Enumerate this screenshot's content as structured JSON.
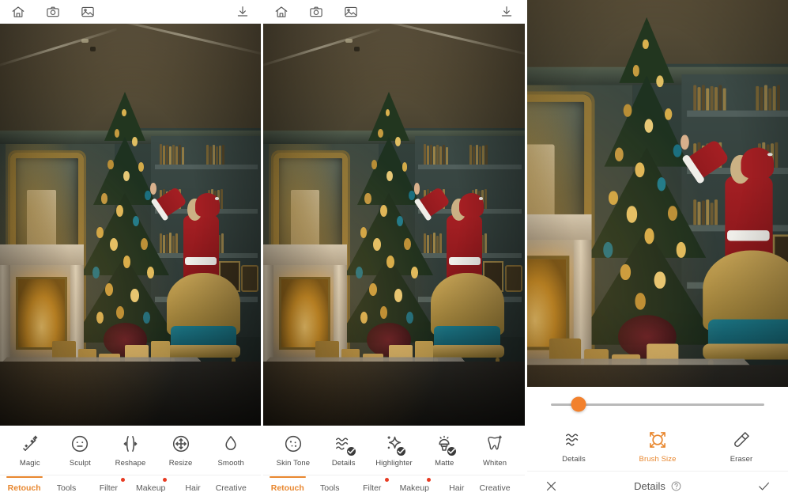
{
  "app": {
    "accent": "#e8872f",
    "slider_accent": "#f2812d",
    "badge_red": "#e83b22"
  },
  "topbar": {
    "icons": [
      {
        "name": "home-icon",
        "label": "Home"
      },
      {
        "name": "camera-icon",
        "label": "Camera"
      },
      {
        "name": "gallery-icon",
        "label": "Gallery"
      }
    ],
    "download": {
      "name": "download-icon",
      "label": "Save"
    }
  },
  "tabs": [
    {
      "label": "Retouch",
      "active": true,
      "dot": false
    },
    {
      "label": "Tools",
      "active": false,
      "dot": false
    },
    {
      "label": "Filter",
      "active": false,
      "dot": true
    },
    {
      "label": "Makeup",
      "active": false,
      "dot": true
    },
    {
      "label": "Hair",
      "active": false,
      "dot": false
    },
    {
      "label": "Creative",
      "active": false,
      "dot": false
    }
  ],
  "panel1": {
    "tools": [
      {
        "label": "Magic",
        "icon": "magic-wand-icon",
        "active": false,
        "checked": false
      },
      {
        "label": "Sculpt",
        "icon": "face-sculpt-icon",
        "active": false,
        "checked": false
      },
      {
        "label": "Reshape",
        "icon": "reshape-icon",
        "active": false,
        "checked": false
      },
      {
        "label": "Resize",
        "icon": "resize-icon",
        "active": false,
        "checked": false
      },
      {
        "label": "Smooth",
        "icon": "droplet-icon",
        "active": false,
        "checked": false
      }
    ]
  },
  "panel2": {
    "tools": [
      {
        "label": "Skin Tone",
        "icon": "skin-tone-icon",
        "active": false,
        "checked": false
      },
      {
        "label": "Details",
        "icon": "details-waves-icon",
        "active": false,
        "checked": true
      },
      {
        "label": "Highlighter",
        "icon": "sparkle-icon",
        "active": false,
        "checked": true
      },
      {
        "label": "Matte",
        "icon": "powder-puff-icon",
        "active": false,
        "checked": true
      },
      {
        "label": "Whiten",
        "icon": "tooth-icon",
        "active": false,
        "checked": false
      }
    ]
  },
  "panel3": {
    "slider": {
      "name": "brush-size-slider",
      "value": 13,
      "min": 0,
      "max": 100
    },
    "tools": [
      {
        "label": "Details",
        "icon": "details-waves-icon",
        "active": false
      },
      {
        "label": "Brush Size",
        "icon": "brush-size-icon",
        "active": true
      },
      {
        "label": "Eraser",
        "icon": "eraser-icon",
        "active": false
      }
    ],
    "footer": {
      "cancel": {
        "name": "close-icon",
        "label": "Cancel"
      },
      "title": "Details",
      "help": {
        "name": "help-icon",
        "label": "Help"
      },
      "confirm": {
        "name": "check-icon",
        "label": "Apply"
      }
    }
  },
  "photo": {
    "description": "Christmas interior: decorated tree, ornate gold mirror, bookcase, lit fireplace, gifts and gold-teal armchair with a person in a Santa suit"
  }
}
